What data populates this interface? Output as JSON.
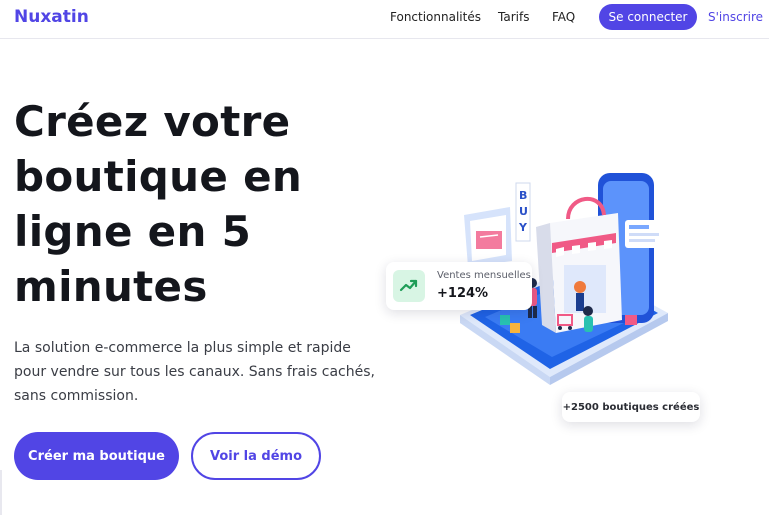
{
  "header": {
    "logo": "Nuxatin",
    "nav": {
      "features": "Fonctionnalités",
      "pricing": "Tarifs",
      "faq": "FAQ"
    },
    "login_button": "Se connecter",
    "signup_link": "S'inscrire"
  },
  "hero": {
    "title": "Créez votre boutique en ligne en 5 minutes",
    "subtitle": "La solution e-commerce la plus simple et rapide pour vendre sur tous les canaux. Sans frais cachés, sans commission.",
    "primary_cta": "Créer ma boutique",
    "secondary_cta": "Voir la démo"
  },
  "illustration": {
    "sign_text": "BUY"
  },
  "stats": {
    "sales_label": "Ventes mensuelles",
    "sales_value": "+124%",
    "stores_text": "+2500 boutiques créées"
  },
  "colors": {
    "brand": "#5145e5",
    "trend_bg": "#d8f5e4",
    "trend_icon": "#1f9d57"
  },
  "icons": {
    "trend": "trending-up-icon"
  }
}
